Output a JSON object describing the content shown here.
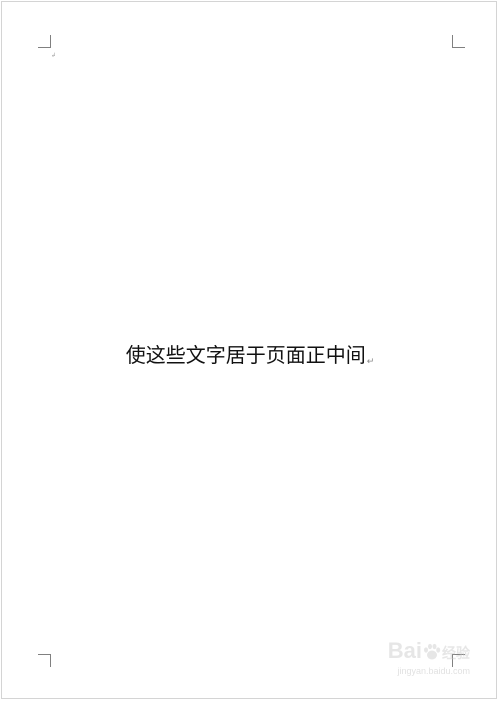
{
  "document": {
    "body_text": "使这些文字居于页面正中间",
    "paragraph_mark": "↵",
    "anchor_mark": "↲"
  },
  "watermark": {
    "logo_text": "Bai",
    "logo_text_after": "经验",
    "url_text": "jingyan.baidu.com"
  },
  "colors": {
    "page_background": "#ffffff",
    "page_border": "#d4d4d4",
    "corner_marks": "#808080",
    "text": "#111111"
  }
}
